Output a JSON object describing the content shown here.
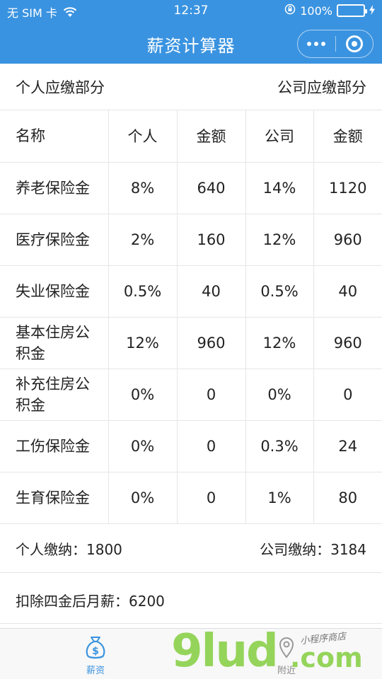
{
  "status_bar": {
    "carrier": "无 SIM 卡",
    "time": "12:37",
    "battery": "100%"
  },
  "nav": {
    "title": "薪资计算器"
  },
  "section_header": {
    "personal": "个人应缴部分",
    "company": "公司应缴部分"
  },
  "table": {
    "headers": [
      "名称",
      "个人",
      "金额",
      "公司",
      "金额"
    ],
    "rows": [
      {
        "name": "养老保险金",
        "personal_rate": "8%",
        "personal_amount": "640",
        "company_rate": "14%",
        "company_amount": "1120"
      },
      {
        "name": "医疗保险金",
        "personal_rate": "2%",
        "personal_amount": "160",
        "company_rate": "12%",
        "company_amount": "960"
      },
      {
        "name": "失业保险金",
        "personal_rate": "0.5%",
        "personal_amount": "40",
        "company_rate": "0.5%",
        "company_amount": "40"
      },
      {
        "name": "基本住房公积金",
        "personal_rate": "12%",
        "personal_amount": "960",
        "company_rate": "12%",
        "company_amount": "960"
      },
      {
        "name": "补充住房公积金",
        "personal_rate": "0%",
        "personal_amount": "0",
        "company_rate": "0%",
        "company_amount": "0"
      },
      {
        "name": "工伤保险金",
        "personal_rate": "0%",
        "personal_amount": "0",
        "company_rate": "0.3%",
        "company_amount": "24"
      },
      {
        "name": "生育保险金",
        "personal_rate": "0%",
        "personal_amount": "0",
        "company_rate": "1%",
        "company_amount": "80"
      }
    ]
  },
  "totals": {
    "personal": "个人缴纳：1800",
    "company": "公司缴纳：3184"
  },
  "net": {
    "text": "扣除四金后月薪：6200"
  },
  "tabbar": {
    "salary": "薪资",
    "nearby": "附近"
  },
  "watermark": {
    "brand": "9lud",
    "suffix": ".com",
    "caption": "小程序商店"
  },
  "colors": {
    "primary": "#3a93e0",
    "watermark": "#8bd14a"
  }
}
